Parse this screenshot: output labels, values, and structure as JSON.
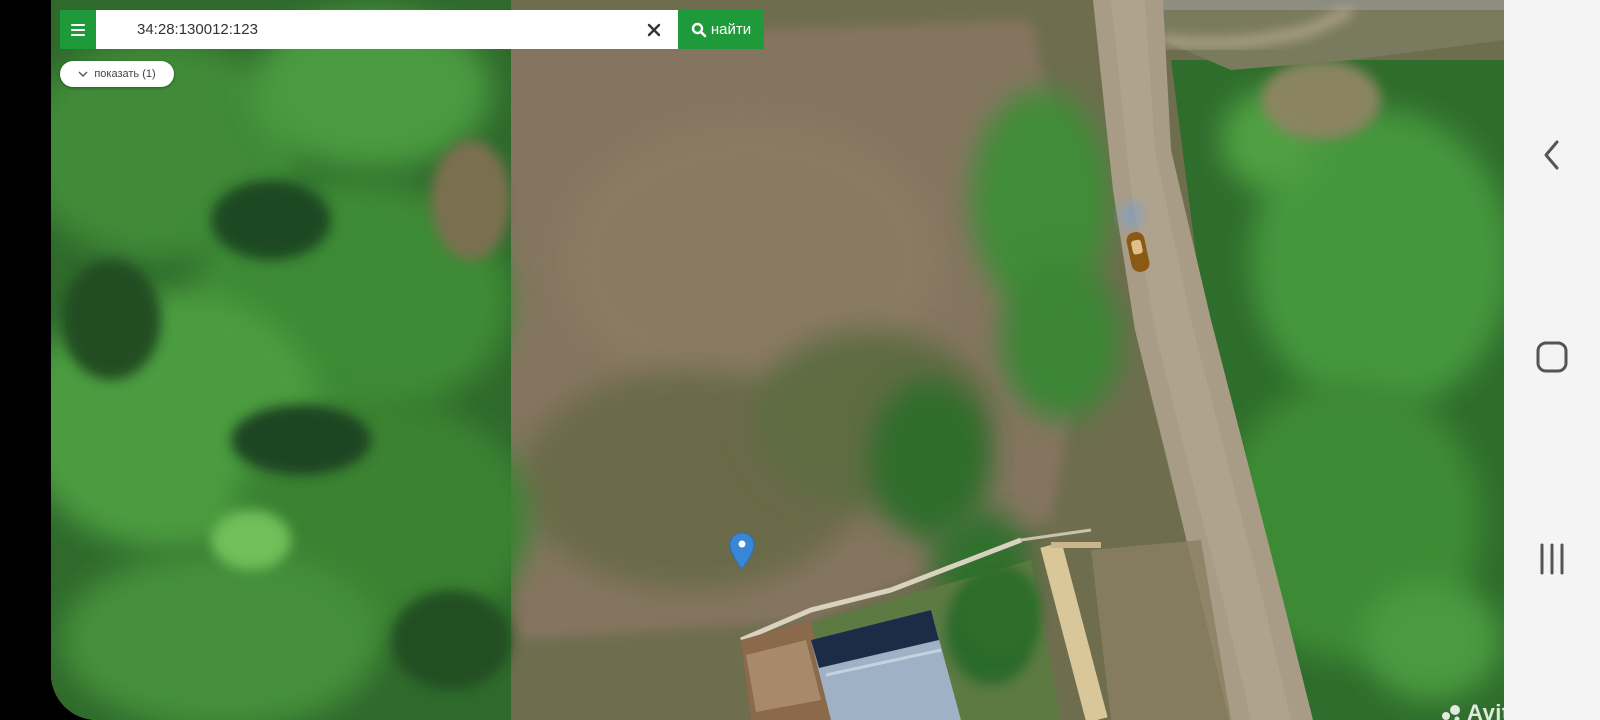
{
  "search": {
    "value": "34:28:130012:123",
    "button_label": "найти"
  },
  "filters": {
    "show_label": "показать (1)"
  },
  "map": {
    "watermark": "Avito"
  },
  "icons": {
    "menu": "hamburger-menu-icon",
    "clear": "close-icon",
    "search": "magnifier-icon",
    "expand": "chevron-down-icon",
    "pin": "map-pin-icon",
    "back": "back-chevron-icon",
    "home": "home-square-icon",
    "recents": "recents-bars-icon"
  },
  "colors": {
    "accent": "#1f9a3a",
    "pin": "#3a86d6",
    "nav_background": "#f4f4f4"
  }
}
